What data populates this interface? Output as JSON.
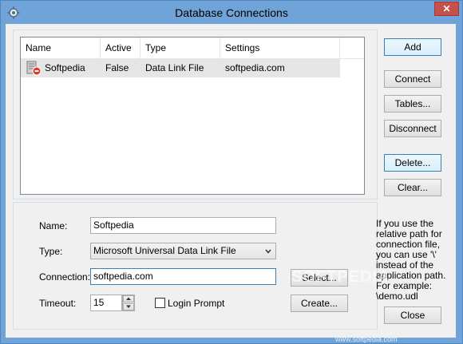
{
  "window": {
    "title": "Database Connections",
    "close_label": "✕"
  },
  "list": {
    "columns": [
      "Name",
      "Active",
      "Type",
      "Settings"
    ],
    "rows": [
      {
        "name": "Softpedia",
        "active": "False",
        "type": "Data Link File",
        "settings": "softpedia.com"
      }
    ]
  },
  "buttons": {
    "add": "Add",
    "connect": "Connect",
    "tables": "Tables...",
    "disconnect": "Disconnect",
    "delete": "Delete...",
    "clear": "Clear...",
    "select": "Select...",
    "create": "Create...",
    "close": "Close"
  },
  "form": {
    "name_label": "Name:",
    "name_value": "Softpedia",
    "type_label": "Type:",
    "type_value": "Microsoft Universal Data Link File",
    "connection_label": "Connection:",
    "connection_value": "softpedia.com",
    "timeout_label": "Timeout:",
    "timeout_value": "15",
    "login_prompt_label": "Login Prompt"
  },
  "hint": {
    "lines": [
      "If you use the",
      "relative path for",
      "connection file,",
      "you can use '\\'",
      "instead of the",
      "application path.",
      "For example:",
      "\\demo.udl"
    ]
  },
  "watermark": {
    "main": "SOFTPEDIA",
    "sub": "www.softpedia.com"
  }
}
